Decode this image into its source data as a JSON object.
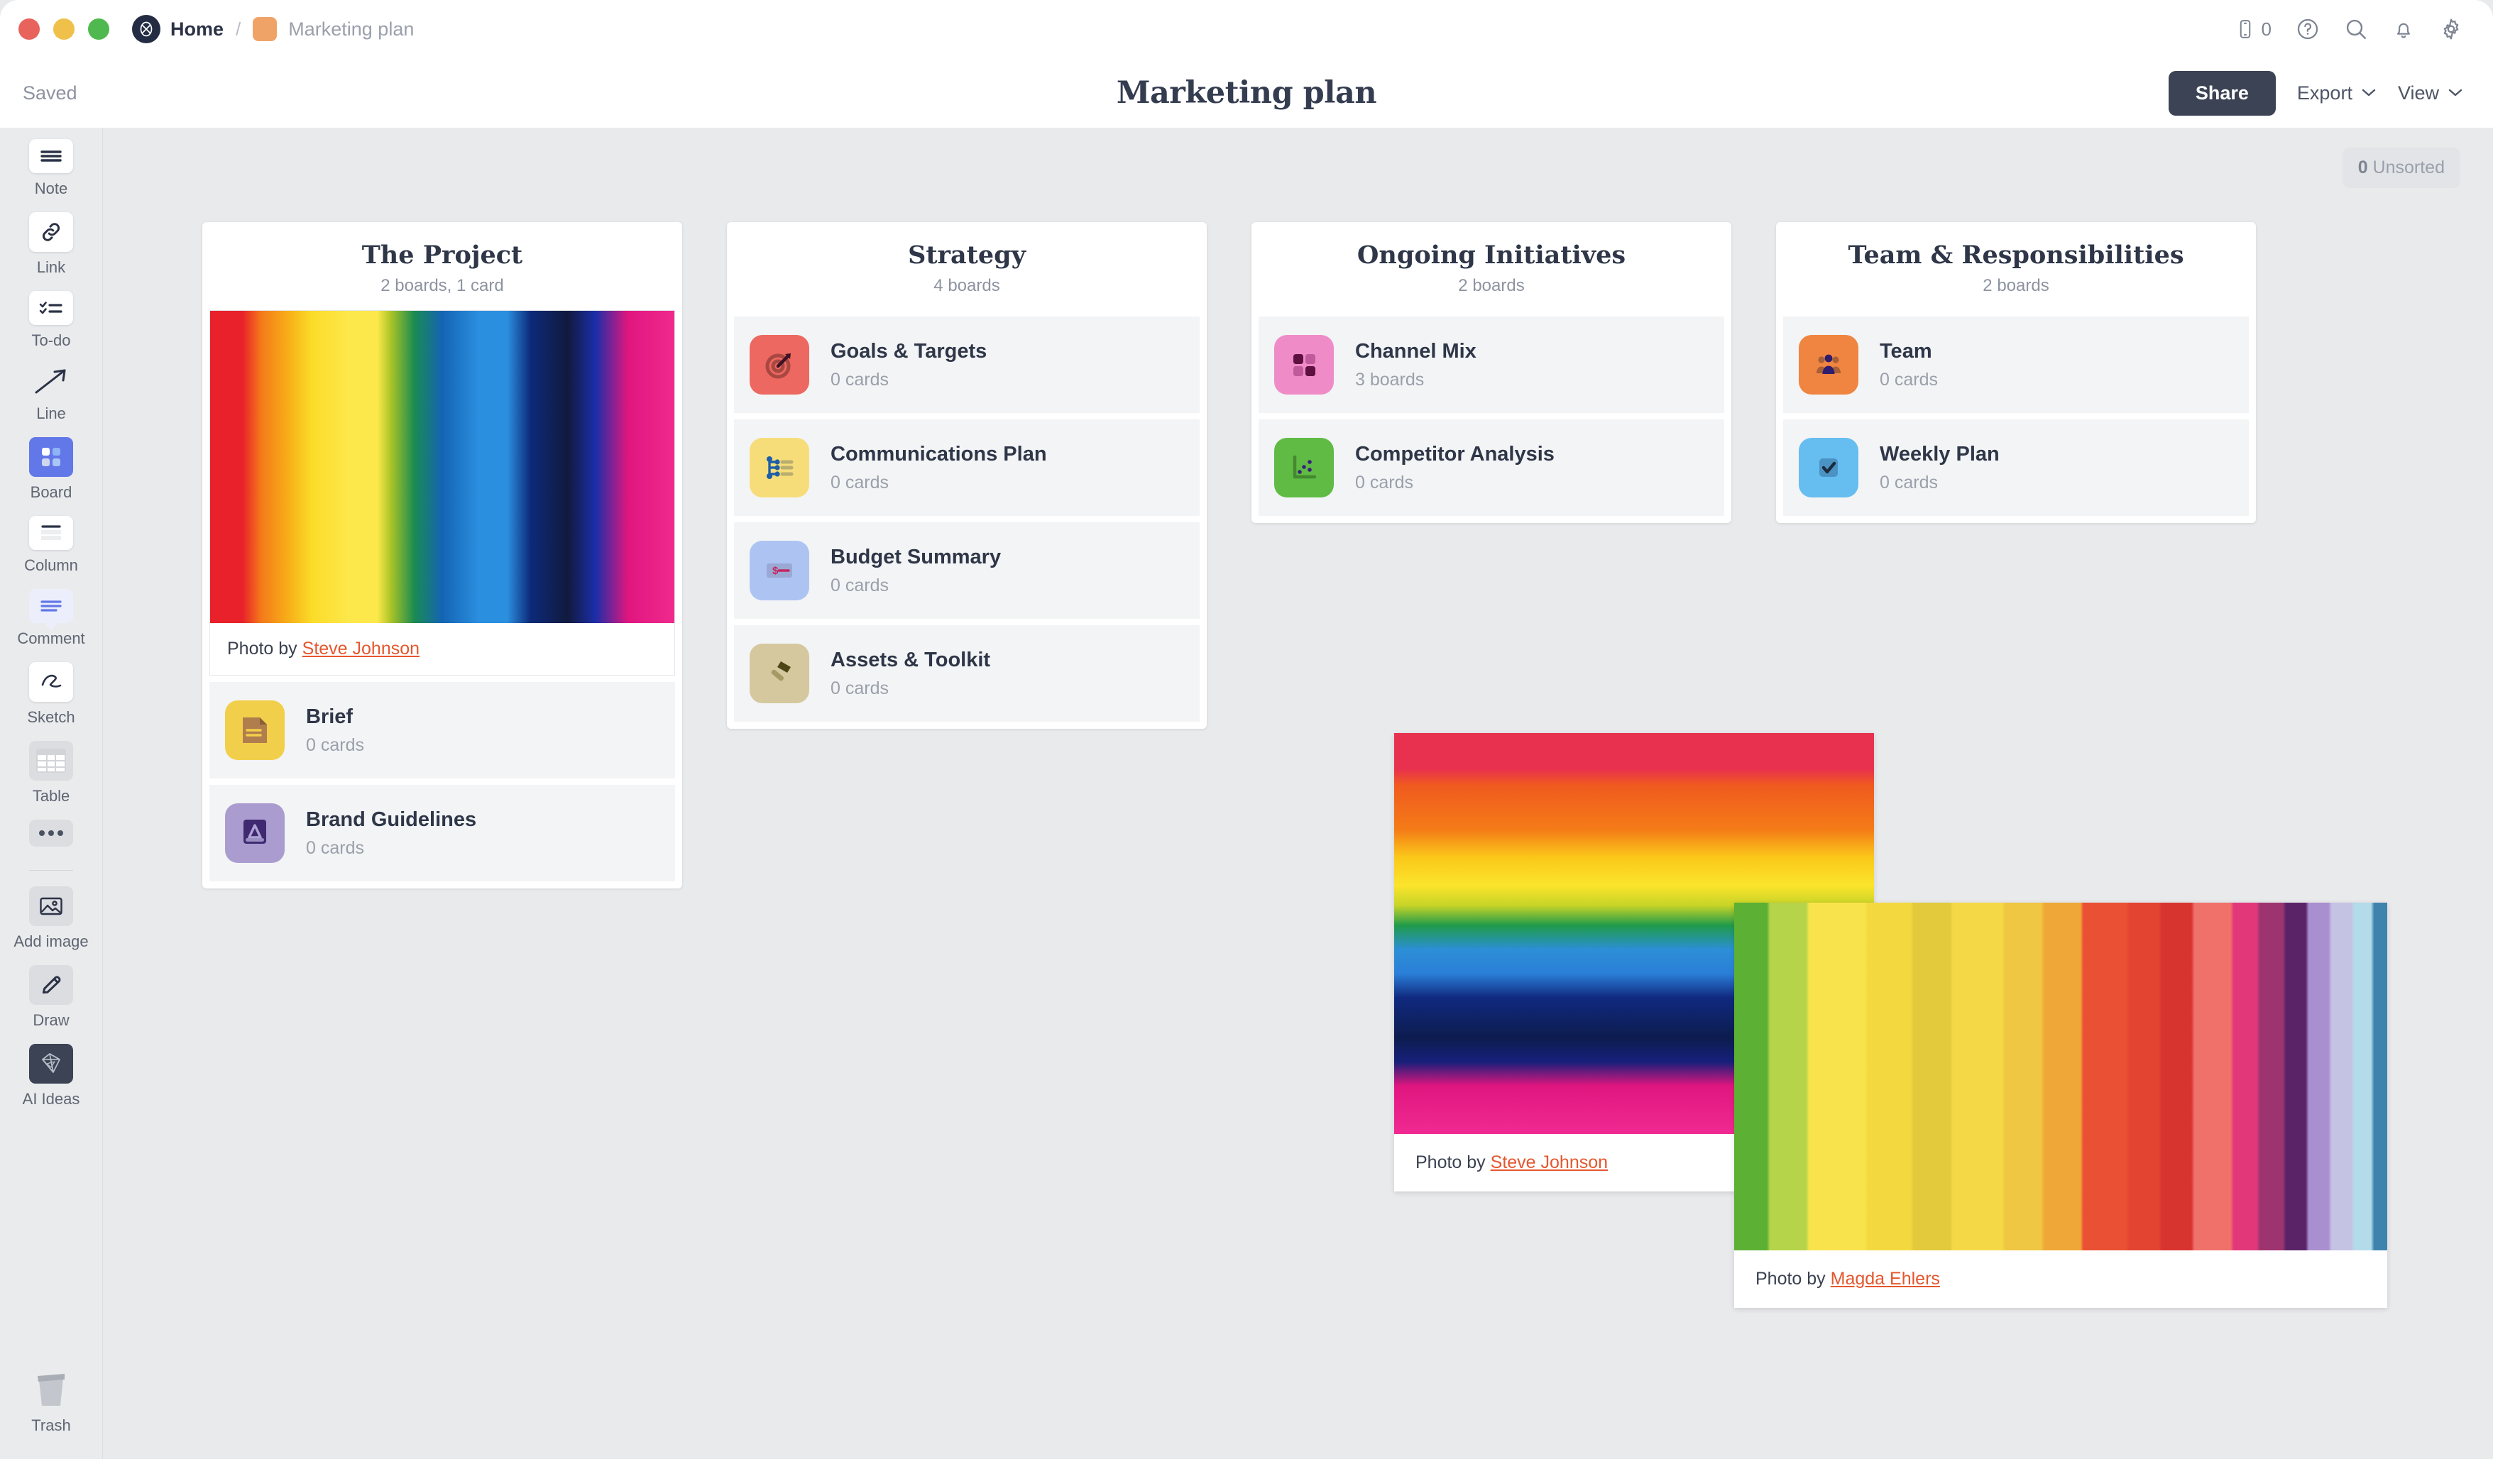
{
  "titlebar": {
    "home_label": "Home",
    "separator": "/",
    "doc_label": "Marketing plan",
    "mobile_count": "0",
    "icons": [
      "mobile-icon",
      "help-icon",
      "search-icon",
      "bell-icon",
      "gear-icon"
    ]
  },
  "subbar": {
    "saved_label": "Saved",
    "title": "Marketing plan",
    "share_label": "Share",
    "export_label": "Export",
    "view_label": "View",
    "chevron": "⌄"
  },
  "rail": {
    "tools": [
      {
        "label": "Note",
        "icon": "note-icon"
      },
      {
        "label": "Link",
        "icon": "link-icon"
      },
      {
        "label": "To-do",
        "icon": "todo-icon"
      },
      {
        "label": "Line",
        "icon": "line-arrow-icon"
      },
      {
        "label": "Board",
        "icon": "board-icon"
      },
      {
        "label": "Column",
        "icon": "column-icon"
      },
      {
        "label": "Comment",
        "icon": "comment-icon"
      },
      {
        "label": "Sketch",
        "icon": "sketch-icon"
      },
      {
        "label": "Table",
        "icon": "table-icon"
      },
      {
        "label": "",
        "icon": "more-dots-icon"
      },
      {
        "label": "Add image",
        "icon": "add-image-icon"
      },
      {
        "label": "Draw",
        "icon": "pencil-icon"
      },
      {
        "label": "AI Ideas",
        "icon": "ai-ideas-icon"
      }
    ],
    "trash_label": "Trash",
    "trash_icon": "trash-icon"
  },
  "canvas": {
    "unsorted_count": "0",
    "unsorted_label": "Unsorted"
  },
  "columns": [
    {
      "title": "The Project",
      "subtitle": "2 boards, 1 card",
      "hero": {
        "credit_prefix": "Photo by ",
        "credit_name": "Steve Johnson"
      },
      "items": [
        {
          "name": "Brief",
          "count": "0 cards",
          "icon": "document-icon",
          "tile": "#f2cf4a",
          "glyph": "#b07d4d"
        },
        {
          "name": "Brand Guidelines",
          "count": "0 cards",
          "icon": "book-icon",
          "tile": "#ab9cd0",
          "glyph": "#3f2a71"
        }
      ]
    },
    {
      "title": "Strategy",
      "subtitle": "4 boards",
      "items": [
        {
          "name": "Goals & Targets",
          "count": "0 cards",
          "icon": "target-icon",
          "tile": "#ec6860",
          "glyph": "#a94741"
        },
        {
          "name": "Communications Plan",
          "count": "0 cards",
          "icon": "sitemap-icon",
          "tile": "#f6dd7a",
          "glyph": "#1c5fa8"
        },
        {
          "name": "Budget Summary",
          "count": "0 cards",
          "icon": "money-icon",
          "tile": "#adc4f3",
          "glyph": "#c4265f"
        },
        {
          "name": "Assets & Toolkit",
          "count": "0 cards",
          "icon": "hammer-icon",
          "tile": "#d6c89e",
          "glyph": "#6b6020"
        }
      ]
    },
    {
      "title": "Ongoing Initiatives",
      "subtitle": "2 boards",
      "items": [
        {
          "name": "Channel Mix",
          "count": "3 boards",
          "icon": "grid-icon",
          "tile": "#ef8cc8",
          "glyph": "#5e1140"
        },
        {
          "name": "Competitor Analysis",
          "count": "0 cards",
          "icon": "scatter-icon",
          "tile": "#5fbb44",
          "glyph": "#3a1f7a"
        }
      ]
    },
    {
      "title": "Team & Responsibilities",
      "subtitle": "2 boards",
      "items": [
        {
          "name": "Team",
          "count": "0 cards",
          "icon": "people-icon",
          "tile": "#ef8541",
          "glyph": "#2f1d6e"
        },
        {
          "name": "Weekly Plan",
          "count": "0 cards",
          "icon": "checkbox-icon",
          "tile": "#66bdf0",
          "glyph": "#1d2b3d"
        }
      ]
    }
  ],
  "photo_cards": [
    {
      "id": "photo-card-steve-johnson",
      "credit_prefix": "Photo by ",
      "credit_name": "Steve Johnson"
    },
    {
      "id": "photo-card-magda-ehlers",
      "credit_prefix": "Photo by ",
      "credit_name": "Magda Ehlers"
    }
  ],
  "colors": {
    "accent_link": "#e4572e",
    "share_button": "#3b4354",
    "board_tool_active": "#6277e8",
    "canvas_bg": "#e9eaec"
  }
}
